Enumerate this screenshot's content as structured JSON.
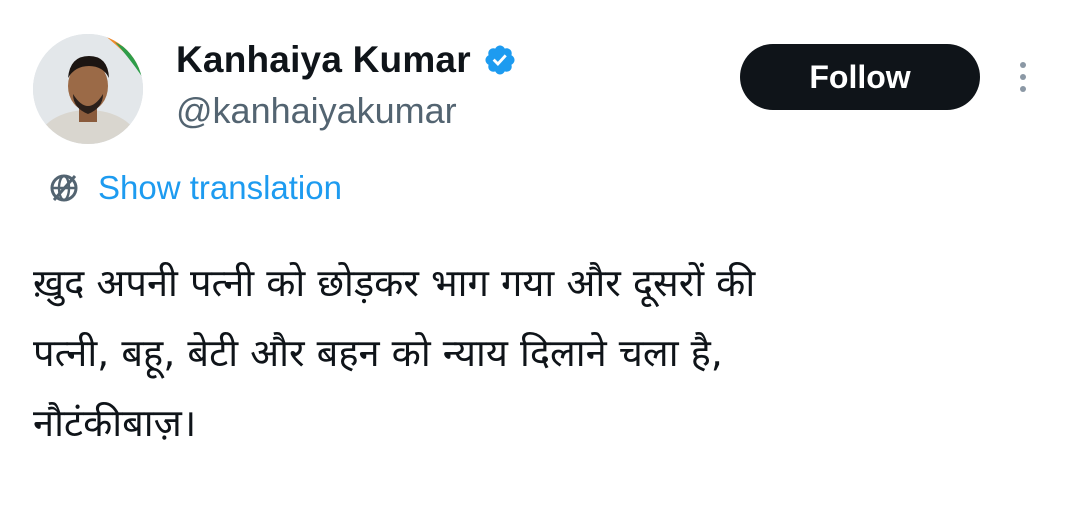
{
  "tweet": {
    "author": {
      "display_name": "Kanhaiya Kumar",
      "handle": "@kanhaiyakumar",
      "verified": true,
      "verified_icon": "verified-badge-icon",
      "verified_color": "#1d9bf0"
    },
    "follow_label": "Follow",
    "more_icon": "more-vertical-icon",
    "translation": {
      "label": "Show translation",
      "icon": "globe-icon"
    },
    "text_lines": [
      "ख़ुद अपनी पत्नी को छोड़कर भाग गया और दूसरों की",
      "पत्नी, बहू, बेटी और बहन को न्याय दिलाने चला है,",
      "नौटंकीबाज़।"
    ]
  },
  "colors": {
    "text_primary": "#0f1419",
    "text_secondary": "#536471",
    "link": "#1d9bf0",
    "button_bg": "#0f1419",
    "button_text": "#ffffff"
  }
}
